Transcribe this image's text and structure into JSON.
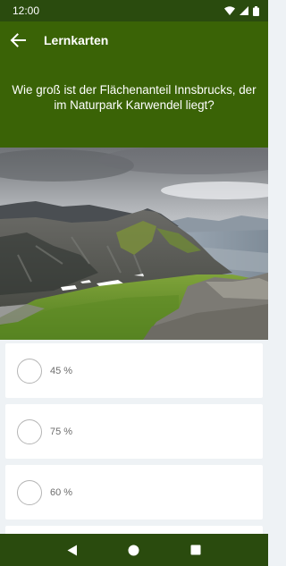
{
  "status_bar": {
    "time": "12:00"
  },
  "app_bar": {
    "title": "Lernkarten",
    "back_icon": "arrow-back-icon"
  },
  "question": {
    "text": "Wie groß ist der Flächenanteil Innsbrucks, der im Naturpark Karwendel liegt?"
  },
  "image": {
    "subject": "mountain-landscape"
  },
  "answers": [
    {
      "label": "45 %"
    },
    {
      "label": "75 %"
    },
    {
      "label": "60 %"
    }
  ],
  "colors": {
    "primary": "#3a6306",
    "primary_dark": "#2a4b0e",
    "background": "#eef2f5",
    "card": "#ffffff"
  }
}
